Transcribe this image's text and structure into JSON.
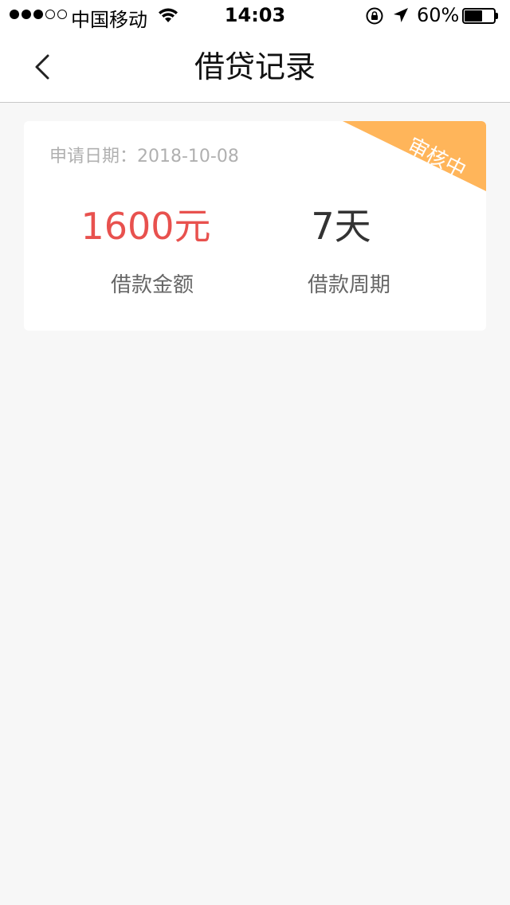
{
  "status_bar": {
    "carrier": "中国移动",
    "time": "14:03",
    "battery_percent": "60%",
    "battery_level": 0.6,
    "signal_bars": 3,
    "signal_total": 5
  },
  "nav": {
    "title": "借贷记录",
    "back_icon": "chevron-left-icon"
  },
  "record": {
    "apply_date": "申请日期：2018-10-08",
    "status": "审核中",
    "status_color": "#ffb55a",
    "amount_value": "1600元",
    "amount_color": "#e8514e",
    "amount_label": "借款金额",
    "period_value": "7天",
    "period_label": "借款周期"
  }
}
